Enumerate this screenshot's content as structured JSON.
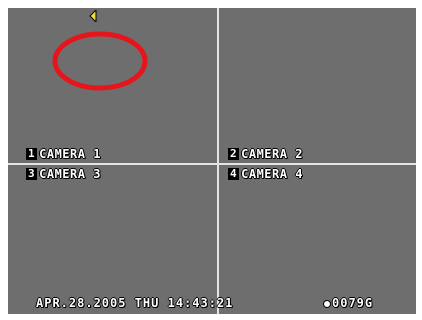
{
  "cameras": [
    {
      "num": "1",
      "label": "CAMERA 1"
    },
    {
      "num": "2",
      "label": "CAMERA 2"
    },
    {
      "num": "3",
      "label": "CAMERA 3"
    },
    {
      "num": "4",
      "label": "CAMERA 4"
    }
  ],
  "status": {
    "datetime": "APR.28.2005 THU 14:43:21",
    "counter": "0079G"
  },
  "icons": {
    "marker": "yellow-arrow-left-icon",
    "disk": "disk-icon"
  },
  "colors": {
    "background": "#6e6e6e",
    "grid_line": "#e4e4e4",
    "annotation": "#e8141c",
    "marker": "#e8e03a"
  }
}
